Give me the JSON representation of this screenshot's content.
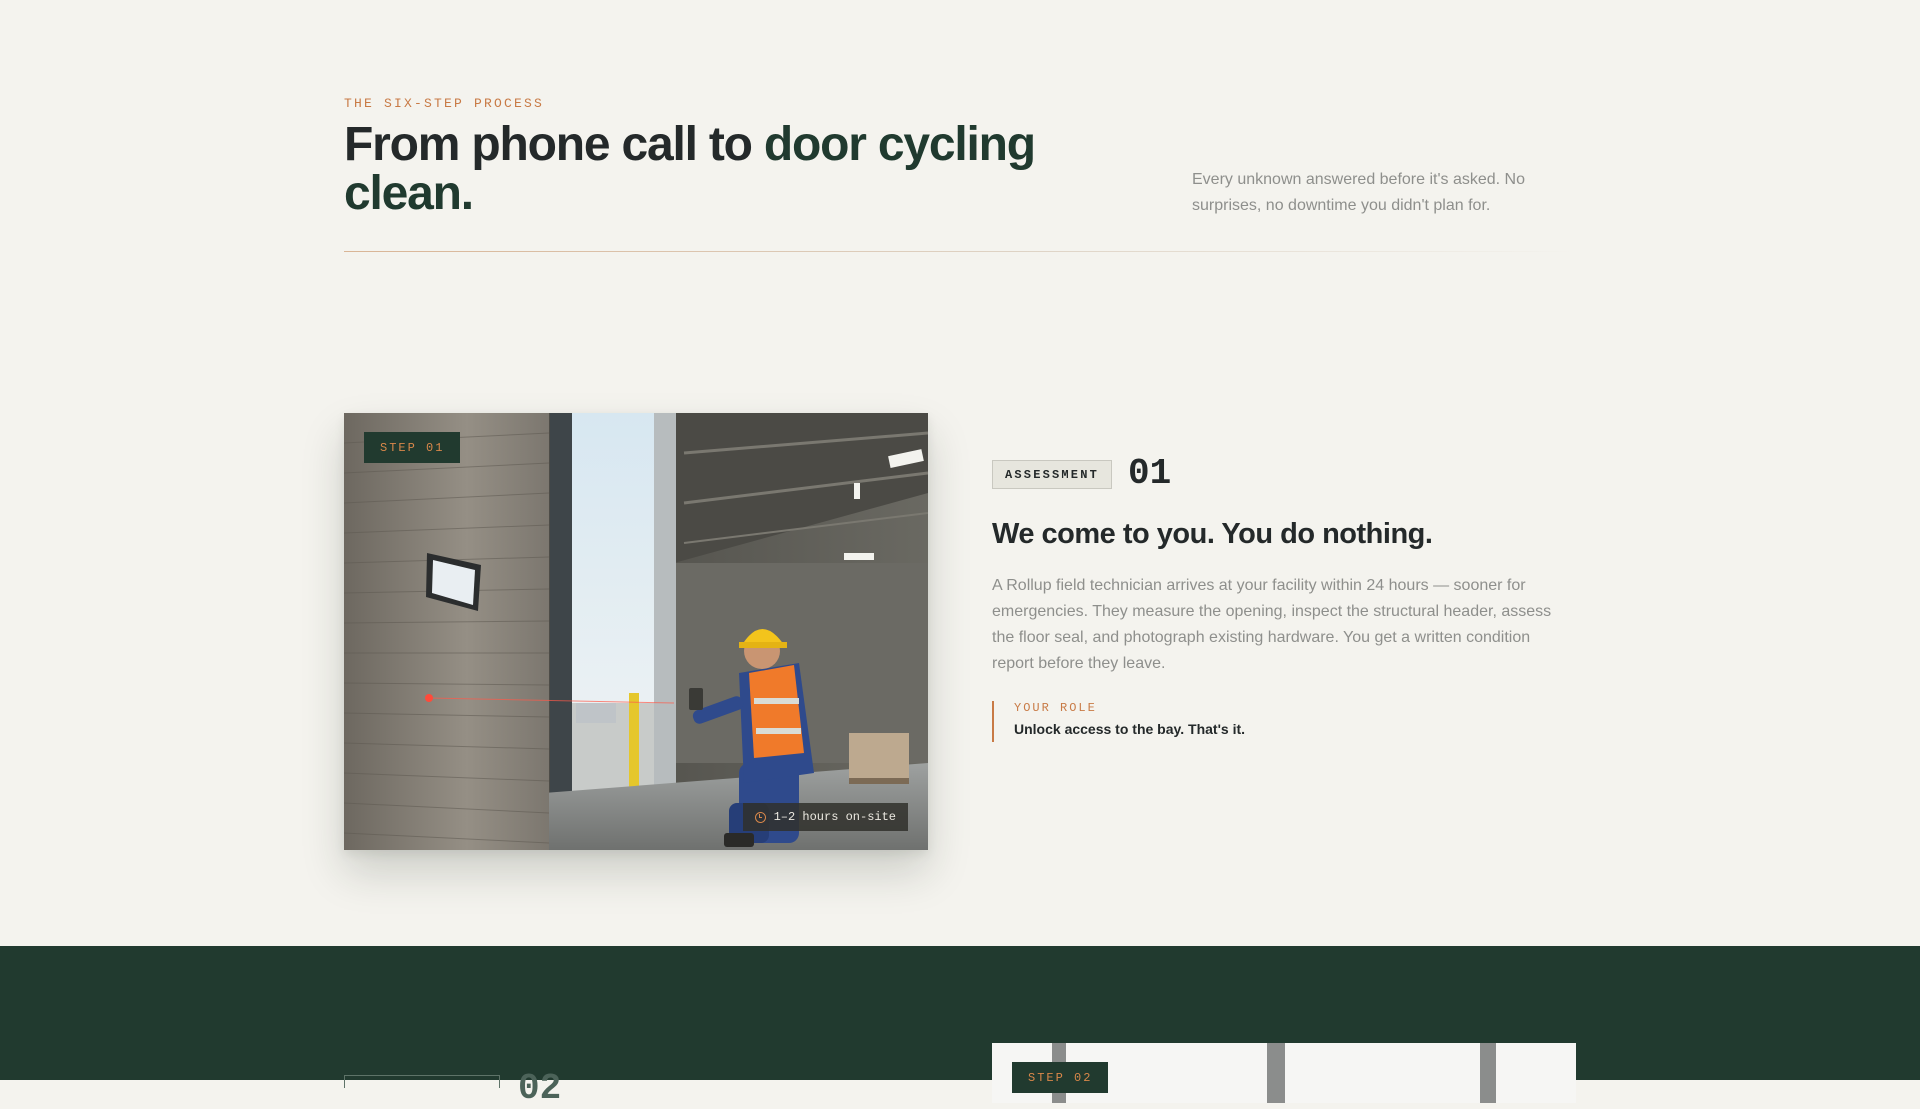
{
  "section": {
    "eyebrow": "THE SIX-STEP PROCESS",
    "headline_part1": "From phone call to ",
    "headline_part2": "door cycling clean.",
    "intro": "Every unknown answered before it's asked. No surprises, no downtime you didn't plan for."
  },
  "step1": {
    "badge": "STEP 01",
    "time_chip": "1–2 hours on-site",
    "tag": "ASSESSMENT",
    "number": "01",
    "title": "We come to you. You do nothing.",
    "description": "A Rollup field technician arrives at your facility within 24 hours — sooner for emergencies. They measure the opening, inspect the structural header, assess the floor seal, and photograph existing hardware. You get a written condition report before they leave.",
    "role_label": "YOUR ROLE",
    "role_text": "Unlock access to the bay. That's it."
  },
  "step2": {
    "badge": "STEP 02",
    "number": "02"
  },
  "colors": {
    "background": "#f4f3ee",
    "accent_orange": "#c87a45",
    "dark_green": "#213a2f",
    "text_dark": "#24292a",
    "text_muted": "#8e8f8c"
  },
  "icons": {
    "clock": "clock-icon"
  }
}
